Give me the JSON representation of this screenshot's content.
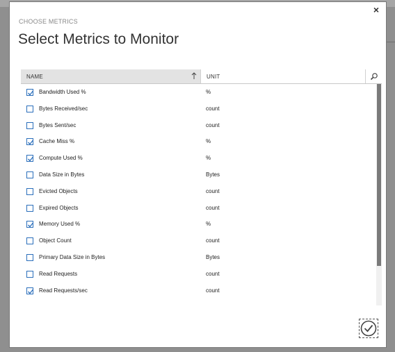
{
  "dialog": {
    "eyebrow": "CHOOSE METRICS",
    "title": "Select Metrics to Monitor",
    "close_glyph": "×"
  },
  "grid": {
    "columns": {
      "name": "NAME",
      "unit": "UNIT"
    },
    "rows": [
      {
        "name": "Bandwidth Used %",
        "unit": "%",
        "checked": true
      },
      {
        "name": "Bytes Received/sec",
        "unit": "count",
        "checked": false
      },
      {
        "name": "Bytes Sent/sec",
        "unit": "count",
        "checked": false
      },
      {
        "name": "Cache Miss %",
        "unit": "%",
        "checked": true
      },
      {
        "name": "Compute Used %",
        "unit": "%",
        "checked": true
      },
      {
        "name": "Data Size in Bytes",
        "unit": "Bytes",
        "checked": false
      },
      {
        "name": "Evicted Objects",
        "unit": "count",
        "checked": false
      },
      {
        "name": "Expired Objects",
        "unit": "count",
        "checked": false
      },
      {
        "name": "Memory Used %",
        "unit": "%",
        "checked": true
      },
      {
        "name": "Object Count",
        "unit": "count",
        "checked": false
      },
      {
        "name": "Primary Data Size in Bytes",
        "unit": "Bytes",
        "checked": false
      },
      {
        "name": "Read Requests",
        "unit": "count",
        "checked": false
      },
      {
        "name": "Read Requests/sec",
        "unit": "count",
        "checked": true
      }
    ]
  },
  "colors": {
    "accent": "#2a6ebb",
    "header_bg": "#e3e3e3",
    "scroll_thumb": "#7a7a7a",
    "overlay": "#8f8f8f"
  },
  "icons": {
    "close": "close-icon",
    "sort": "sort-ascending-icon",
    "search": "search-icon",
    "confirm": "checkmark-circle-icon"
  }
}
